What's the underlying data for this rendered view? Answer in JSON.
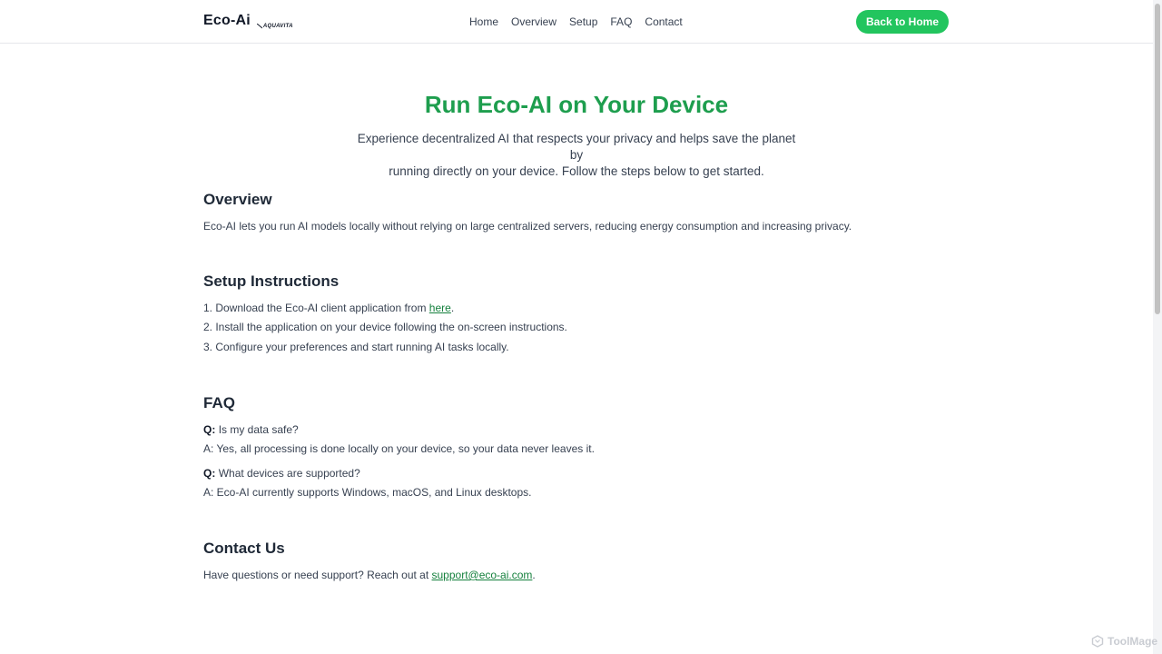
{
  "brand": {
    "name": "Eco-Ai",
    "sub": "AQUAVITA"
  },
  "nav": {
    "items": [
      "Home",
      "Overview",
      "Setup",
      "FAQ",
      "Contact"
    ]
  },
  "header_button": "Back to Home",
  "hero": {
    "title": "Run Eco-AI on Your Device",
    "desc_line1": "Experience decentralized AI that respects your privacy and helps save the planet by",
    "desc_line2": "running directly on your device. Follow the steps below to get started."
  },
  "overview": {
    "title": "Overview",
    "text": "Eco-AI lets you run AI models locally without relying on large centralized servers, reducing energy consumption and increasing privacy."
  },
  "setup": {
    "title": "Setup Instructions",
    "step1_prefix": "1. Download the Eco-AI client application from ",
    "step1_link": "here",
    "step1_suffix": ".",
    "step2": "2. Install the application on your device following the on-screen instructions.",
    "step3": "3. Configure your preferences and start running AI tasks locally."
  },
  "faq": {
    "title": "FAQ",
    "q_label": "Q:",
    "items": [
      {
        "q": "Is my data safe?",
        "a": "A: Yes, all processing is done locally on your device, so your data never leaves it."
      },
      {
        "q": "What devices are supported?",
        "a": "A: Eco-AI currently supports Windows, macOS, and Linux desktops."
      }
    ]
  },
  "contact": {
    "title": "Contact Us",
    "prefix": "Have questions or need support? Reach out at ",
    "email": "support@eco-ai.com",
    "suffix": "."
  },
  "watermark": "ToolMage",
  "colors": {
    "accent": "#22c55e",
    "title_green": "#1e9e4e",
    "link_green": "#15803d"
  }
}
